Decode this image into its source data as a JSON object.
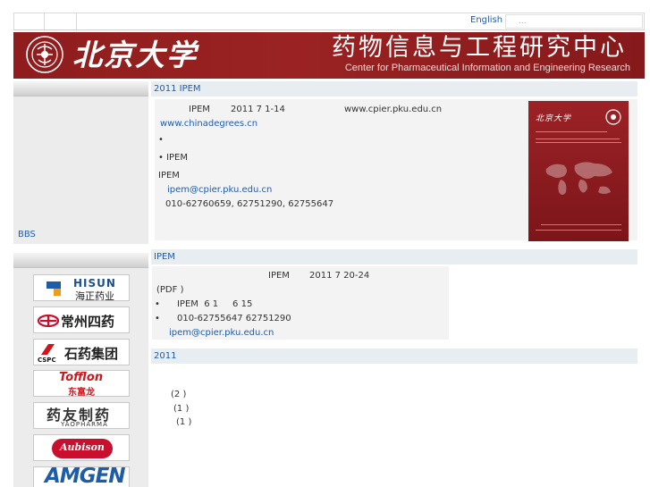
{
  "topbar": {
    "language_link": "English",
    "search_placeholder": "..."
  },
  "banner": {
    "university_name": "北京大学",
    "center_name_cn": "药物信息与工程研究中心",
    "center_name_en": "Center for Pharmaceutical Information and Engineering Research",
    "brand_color": "#8f1d1d"
  },
  "sidebar": {
    "bbs_link": "BBS",
    "sponsor_logos": [
      {
        "name": "hisun",
        "text": "HISUN",
        "subtext": "海正药业"
      },
      {
        "name": "changzhou-siyao",
        "text": "常州四药"
      },
      {
        "name": "cspc",
        "text": "石药集团",
        "subtext": "CSPC"
      },
      {
        "name": "tofflon",
        "text": "Tofflon",
        "subtext": "东富龙"
      },
      {
        "name": "yaopharma",
        "text": "药友制药",
        "subtext": "YAOPHARMA"
      },
      {
        "name": "aubison",
        "text": "Aubison"
      },
      {
        "name": "amgen",
        "text": "AMGEN"
      }
    ]
  },
  "section1": {
    "title": "2011 IPEM",
    "line1_org": "IPEM",
    "line1_date": "2011 7 1-14",
    "line1_url": "www.cpier.pku.edu.cn",
    "link1": "www.chinadegrees.cn",
    "bullet1": "•",
    "bullet2": "• IPEM",
    "org_label": "IPEM",
    "email": "ipem@cpier.pku.edu.cn",
    "phone": "010-62760659, 62751290, 62755647",
    "cover": {
      "university_name": "北京大学"
    }
  },
  "section2": {
    "title": "IPEM",
    "line1_org": "IPEM",
    "line1_date": "2011 7 20-24",
    "pdf_note": "(PDF )",
    "bullet_line1": "•      IPEM  6 1     6 15",
    "bullet_line2": "•      010-62755647 62751290",
    "email": "ipem@cpier.pku.edu.cn"
  },
  "section3": {
    "title": "2011",
    "items": [
      "(2 )",
      "(1 )",
      "(1 )"
    ]
  }
}
